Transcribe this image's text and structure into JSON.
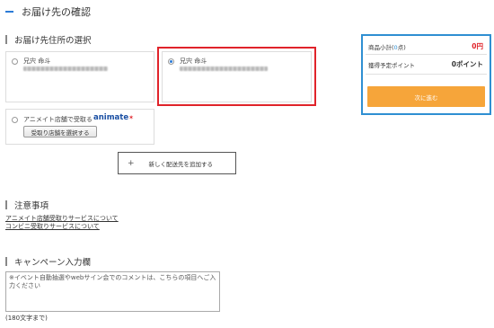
{
  "page_title": "お届け先の確認",
  "address_section": {
    "heading": "お届け先住所の選択",
    "cards": [
      {
        "name": "兄宍 命斗",
        "selected": false
      },
      {
        "name": "兄宍 命斗",
        "selected": true
      }
    ],
    "store_pickup": {
      "label": "アニメイト店舗で受取る",
      "logo_text": "animate",
      "select_button": "受取り店舗を選択する"
    },
    "add_button": "新しく配送先を追加する",
    "add_icon": "+"
  },
  "notes": {
    "heading": "注意事項",
    "links": [
      "アニメイト店舗受取りサービスについて",
      "コンビニ受取りサービスについて"
    ]
  },
  "campaign": {
    "heading": "キャンペーン入力欄",
    "textarea_placeholder": "※イベント自動抽選やwebサイン会でのコメントは、こちらの項目へご入力ください",
    "char_limit": "(180文字まで)"
  },
  "summary": {
    "subtotal_label": "商品小計(",
    "subtotal_count": "0",
    "subtotal_unit": "点)",
    "subtotal_value": "0円",
    "points_label": "獲得予定ポイント",
    "points_value": "0ポイント",
    "next_button": "次に進む"
  },
  "colors": {
    "accent_blue": "#2f8fd2",
    "selected_border": "#e0232a",
    "next_button": "#f6a53a",
    "price_red": "#e0232a"
  }
}
